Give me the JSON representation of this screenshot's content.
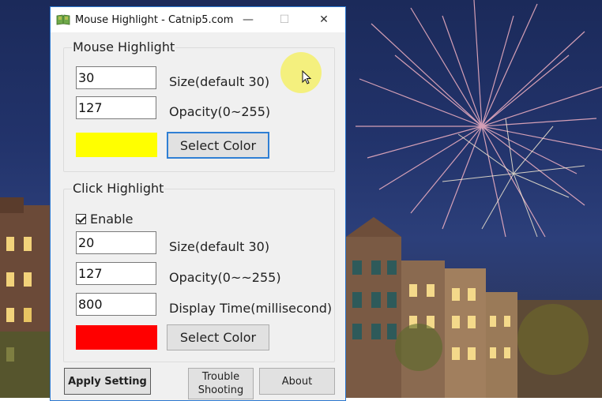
{
  "window": {
    "title": "Mouse Highlight - Catnip5.com",
    "minimize_glyph": "—",
    "maximize_glyph": "☐",
    "close_glyph": "✕"
  },
  "mouse_highlight": {
    "group_label": "Mouse Highlight",
    "size_value": "30",
    "size_label": "Size(default 30)",
    "opacity_value": "127",
    "opacity_label": "Opacity(0~255)",
    "color": "#ffff00",
    "select_color_label": "Select Color"
  },
  "click_highlight": {
    "group_label": "Click Highlight",
    "enable_label": "Enable",
    "enable_checked": true,
    "size_value": "20",
    "size_label": "Size(default 30)",
    "opacity_value": "127",
    "opacity_label": "Opacity(0~~255)",
    "display_time_value": "800",
    "display_time_label": "Display Time(millisecond)",
    "color": "#ff0000",
    "select_color_label": "Select Color"
  },
  "footer": {
    "apply_label": "Apply Setting",
    "trouble_label_line1": "Trouble",
    "trouble_label_line2": "Shooting",
    "about_label": "About"
  },
  "cursor_highlight_color": "#f5f06a"
}
